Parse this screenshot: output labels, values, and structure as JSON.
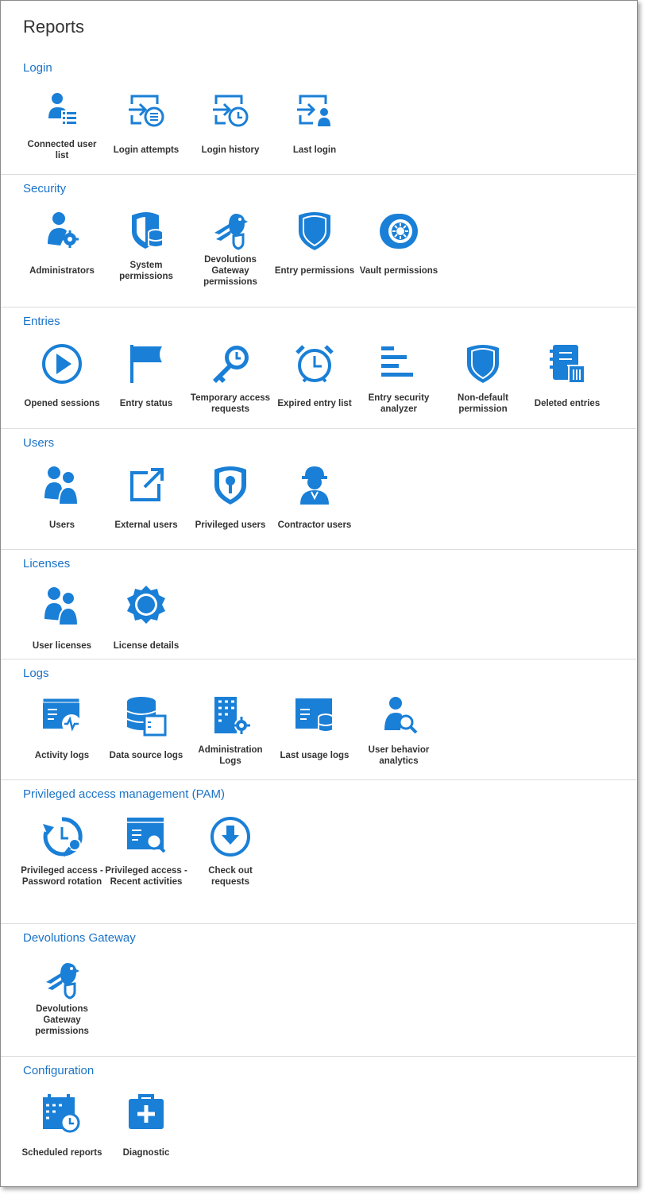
{
  "page_title": "Reports",
  "accent": "#1a7fd6",
  "sections": [
    {
      "title": "Login",
      "items": [
        {
          "label": "Connected user list",
          "icon": "connected-user-list-icon"
        },
        {
          "label": "Login attempts",
          "icon": "login-attempts-icon"
        },
        {
          "label": "Login history",
          "icon": "login-history-icon"
        },
        {
          "label": "Last login",
          "icon": "last-login-icon"
        }
      ]
    },
    {
      "title": "Security",
      "items": [
        {
          "label": "Administrators",
          "icon": "administrators-icon"
        },
        {
          "label": "System permissions",
          "icon": "system-permissions-icon"
        },
        {
          "label": "Devolutions Gateway permissions",
          "icon": "gateway-permissions-icon"
        },
        {
          "label": "Entry permissions",
          "icon": "entry-permissions-icon"
        },
        {
          "label": "Vault permissions",
          "icon": "vault-permissions-icon"
        }
      ]
    },
    {
      "title": "Entries",
      "items": [
        {
          "label": "Opened sessions",
          "icon": "opened-sessions-icon"
        },
        {
          "label": "Entry status",
          "icon": "entry-status-icon"
        },
        {
          "label": "Temporary access requests",
          "icon": "temporary-access-icon"
        },
        {
          "label": "Expired entry list",
          "icon": "expired-entry-icon"
        },
        {
          "label": "Entry security analyzer",
          "icon": "security-analyzer-icon"
        },
        {
          "label": "Non-default permission",
          "icon": "non-default-permission-icon"
        },
        {
          "label": "Deleted entries",
          "icon": "deleted-entries-icon"
        }
      ]
    },
    {
      "title": "Users",
      "items": [
        {
          "label": "Users",
          "icon": "users-icon"
        },
        {
          "label": "External users",
          "icon": "external-users-icon"
        },
        {
          "label": "Privileged users",
          "icon": "privileged-users-icon"
        },
        {
          "label": "Contractor users",
          "icon": "contractor-users-icon"
        }
      ]
    },
    {
      "title": "Licenses",
      "items": [
        {
          "label": "User licenses",
          "icon": "user-licenses-icon"
        },
        {
          "label": "License details",
          "icon": "license-details-icon"
        }
      ]
    },
    {
      "title": "Logs",
      "items": [
        {
          "label": "Activity logs",
          "icon": "activity-logs-icon"
        },
        {
          "label": "Data source logs",
          "icon": "data-source-logs-icon"
        },
        {
          "label": "Administration Logs",
          "icon": "administration-logs-icon"
        },
        {
          "label": "Last usage logs",
          "icon": "last-usage-logs-icon"
        },
        {
          "label": "User behavior analytics",
          "icon": "user-behavior-icon"
        }
      ]
    },
    {
      "title": "Privileged access management (PAM)",
      "items": [
        {
          "label": "Privileged access - Password rotation",
          "icon": "password-rotation-icon"
        },
        {
          "label": "Privileged access - Recent activities",
          "icon": "recent-activities-icon"
        },
        {
          "label": "Check out requests",
          "icon": "check-out-requests-icon"
        }
      ]
    },
    {
      "title": "Devolutions Gateway",
      "items": [
        {
          "label": "Devolutions Gateway permissions",
          "icon": "gateway-permissions-icon"
        }
      ]
    },
    {
      "title": "Configuration",
      "items": [
        {
          "label": "Scheduled reports",
          "icon": "scheduled-reports-icon"
        },
        {
          "label": "Diagnostic",
          "icon": "diagnostic-icon"
        }
      ]
    }
  ]
}
